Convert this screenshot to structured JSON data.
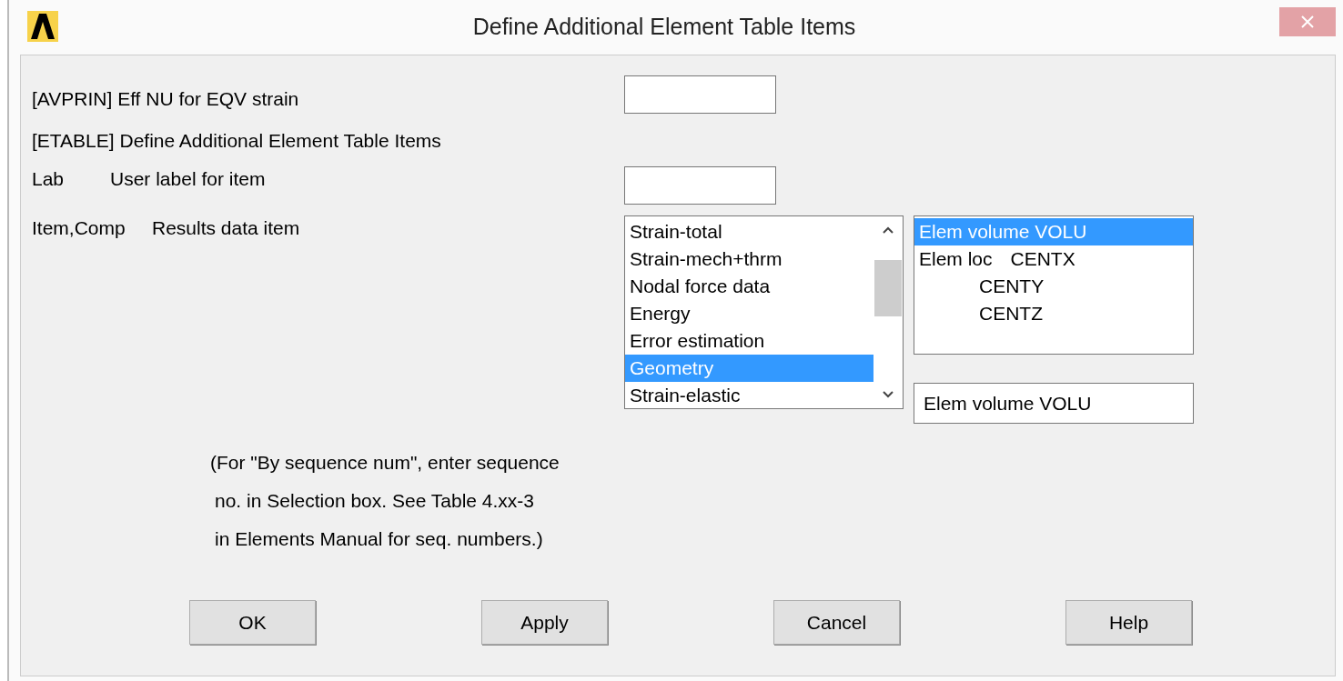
{
  "window": {
    "title": "Define Additional Element Table Items"
  },
  "avprin": {
    "label": "[AVPRIN]  Eff NU for EQV strain"
  },
  "etable": {
    "heading": "[ETABLE]  Define Additional Element Table Items"
  },
  "lab": {
    "code": "Lab",
    "label": "User label for item"
  },
  "item": {
    "code": "Item,Comp",
    "label": "Results data item",
    "categories": [
      {
        "text": "Strain-total",
        "selected": false
      },
      {
        "text": "Strain-mech+thrm",
        "selected": false
      },
      {
        "text": "Nodal force data",
        "selected": false
      },
      {
        "text": "Energy",
        "selected": false
      },
      {
        "text": "Error estimation",
        "selected": false
      },
      {
        "text": "Geometry",
        "selected": true
      },
      {
        "text": "Strain-elastic",
        "selected": false
      }
    ],
    "components": [
      {
        "label": "Elem volume VOLU",
        "selected": true
      },
      {
        "label": "Elem loc",
        "code": "CENTX",
        "selected": false
      },
      {
        "code": "CENTY",
        "selected": false
      },
      {
        "code": "CENTZ",
        "selected": false
      }
    ],
    "selection": "Elem volume VOLU"
  },
  "note": [
    "(For \"By sequence num\", enter sequence",
    "no. in Selection box.  See Table 4.xx-3",
    "in Elements Manual for seq. numbers.)"
  ],
  "buttons": [
    "OK",
    "Apply",
    "Cancel",
    "Help"
  ]
}
